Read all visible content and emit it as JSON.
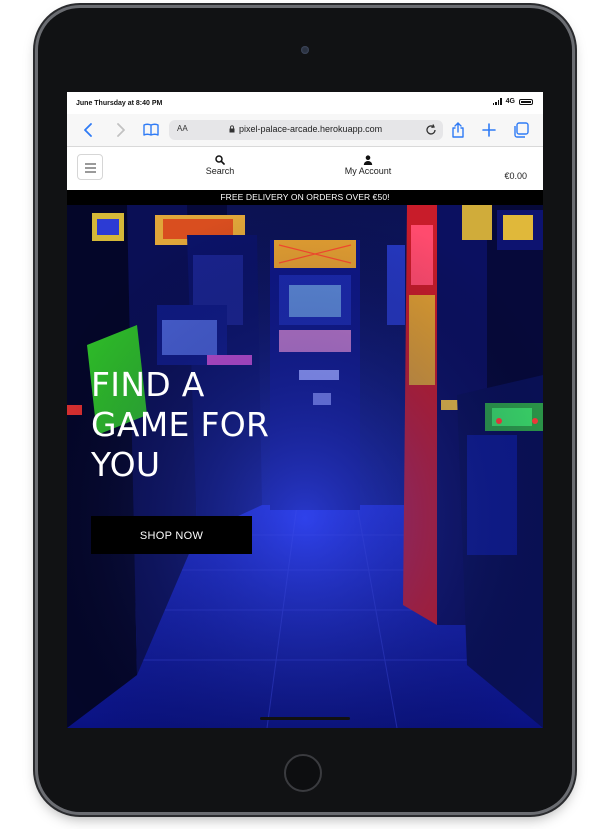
{
  "status_bar": {
    "time": "June Thursday at 8:40 PM",
    "network": "4G"
  },
  "browser": {
    "text_size_label": "AA",
    "url": "pixel-palace-arcade.herokuapp.com"
  },
  "header": {
    "search_label": "Search",
    "account_label": "My Account",
    "cart_total": "€0.00"
  },
  "banner": {
    "delivery_text": "FREE DELIVERY ON ORDERS OVER €50!"
  },
  "hero": {
    "title": "FIND A\nGAME FOR\nYOU",
    "cta_label": "SHOP NOW"
  },
  "colors": {
    "browser_accent": "#2f7bf5",
    "banner_bg": "#000000",
    "cta_bg": "#000000",
    "hero_tint": "#1a2cff"
  }
}
